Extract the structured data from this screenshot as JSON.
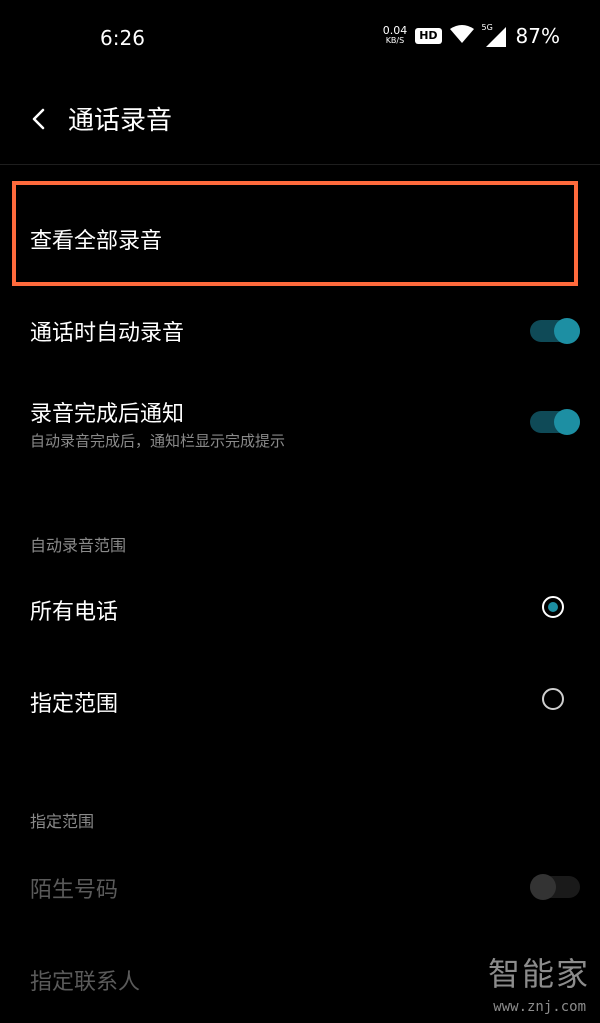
{
  "status_bar": {
    "time": "6:26",
    "net_speed_value": "0.04",
    "net_speed_unit": "KB/S",
    "hd_label": "HD",
    "network_label": "5G",
    "battery": "87%",
    "icons": [
      "wifi-icon",
      "cellular-signal-icon"
    ]
  },
  "header": {
    "title": "通话录音",
    "back_icon": "chevron-left-icon"
  },
  "rows": {
    "view_all": {
      "label": "查看全部录音"
    },
    "auto_record": {
      "label": "通话时自动录音",
      "enabled": true
    },
    "notify_done": {
      "label": "录音完成后通知",
      "subtitle": "自动录音完成后，通知栏显示完成提示",
      "enabled": true
    }
  },
  "range_section": {
    "header": "自动录音范围",
    "options": [
      {
        "label": "所有电话",
        "selected": true
      },
      {
        "label": "指定范围",
        "selected": false
      }
    ]
  },
  "specified_section": {
    "header": "指定范围",
    "items": [
      {
        "label": "陌生号码",
        "enabled": false,
        "disabled": true
      },
      {
        "label": "指定联系人",
        "disabled": true
      }
    ]
  },
  "watermark": {
    "text": "智能家",
    "url": "www.znj.com"
  },
  "colors": {
    "background": "#000000",
    "accent": "#1d8fa3",
    "highlight_border": "#ff6a3c",
    "secondary_text": "#8a8a8a",
    "disabled_text": "#5a5a5a"
  }
}
